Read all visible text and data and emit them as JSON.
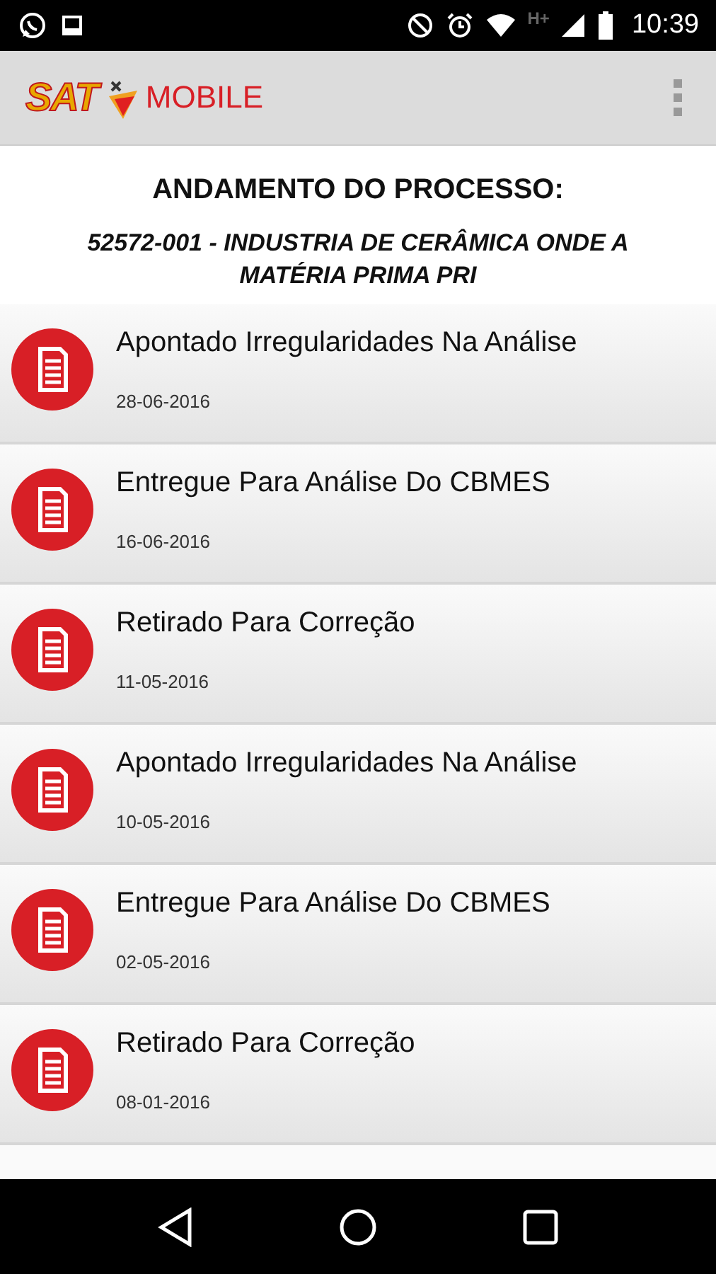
{
  "status_bar": {
    "time": "10:39",
    "network": "H+"
  },
  "app_bar": {
    "logo_text": "SAT",
    "title": "MOBILE"
  },
  "header": {
    "title": "ANDAMENTO DO PROCESSO:",
    "subtitle": "52572-001 - INDUSTRIA DE CERÂMICA ONDE A MATÉRIA PRIMA PRI"
  },
  "items": [
    {
      "title": "Apontado Irregularidades Na Análise",
      "date": "28-06-2016"
    },
    {
      "title": "Entregue Para Análise Do CBMES",
      "date": "16-06-2016"
    },
    {
      "title": "Retirado Para Correção",
      "date": "11-05-2016"
    },
    {
      "title": "Apontado Irregularidades Na Análise",
      "date": "10-05-2016"
    },
    {
      "title": "Entregue Para Análise Do CBMES",
      "date": "02-05-2016"
    },
    {
      "title": "Retirado Para Correção",
      "date": "08-01-2016"
    }
  ]
}
